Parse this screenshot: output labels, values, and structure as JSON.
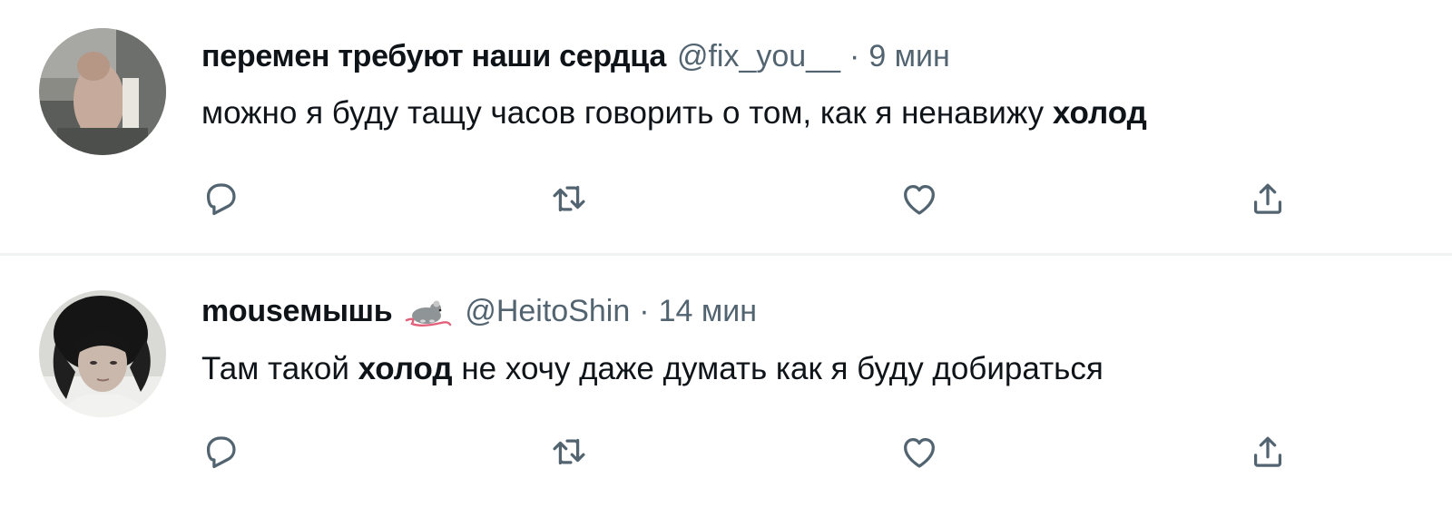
{
  "tweets": [
    {
      "display_name": "перемен требуют наши сердца",
      "handle": "@fix_you__",
      "separator": "·",
      "time": "9 мин",
      "text_before": "можно я буду тащу часов говорить о том, как я ненавижу ",
      "text_bold": "холод",
      "text_after": "",
      "avatar_icon": "avatar-photo",
      "actions": [
        "reply-icon",
        "retweet-icon",
        "like-icon",
        "share-icon"
      ]
    },
    {
      "display_name": "mouseмышь",
      "name_emoji": "rat-emoji",
      "handle": "@HeitoShin",
      "separator": "·",
      "time": "14 мин",
      "text_before": "Там такой ",
      "text_bold": "холод",
      "text_after": " не хочу даже думать как я буду добираться",
      "avatar_icon": "avatar-photo",
      "actions": [
        "reply-icon",
        "retweet-icon",
        "like-icon",
        "share-icon"
      ]
    }
  ],
  "colors": {
    "text_primary": "#0f1419",
    "text_secondary": "#536471",
    "divider": "#eff3f4"
  }
}
